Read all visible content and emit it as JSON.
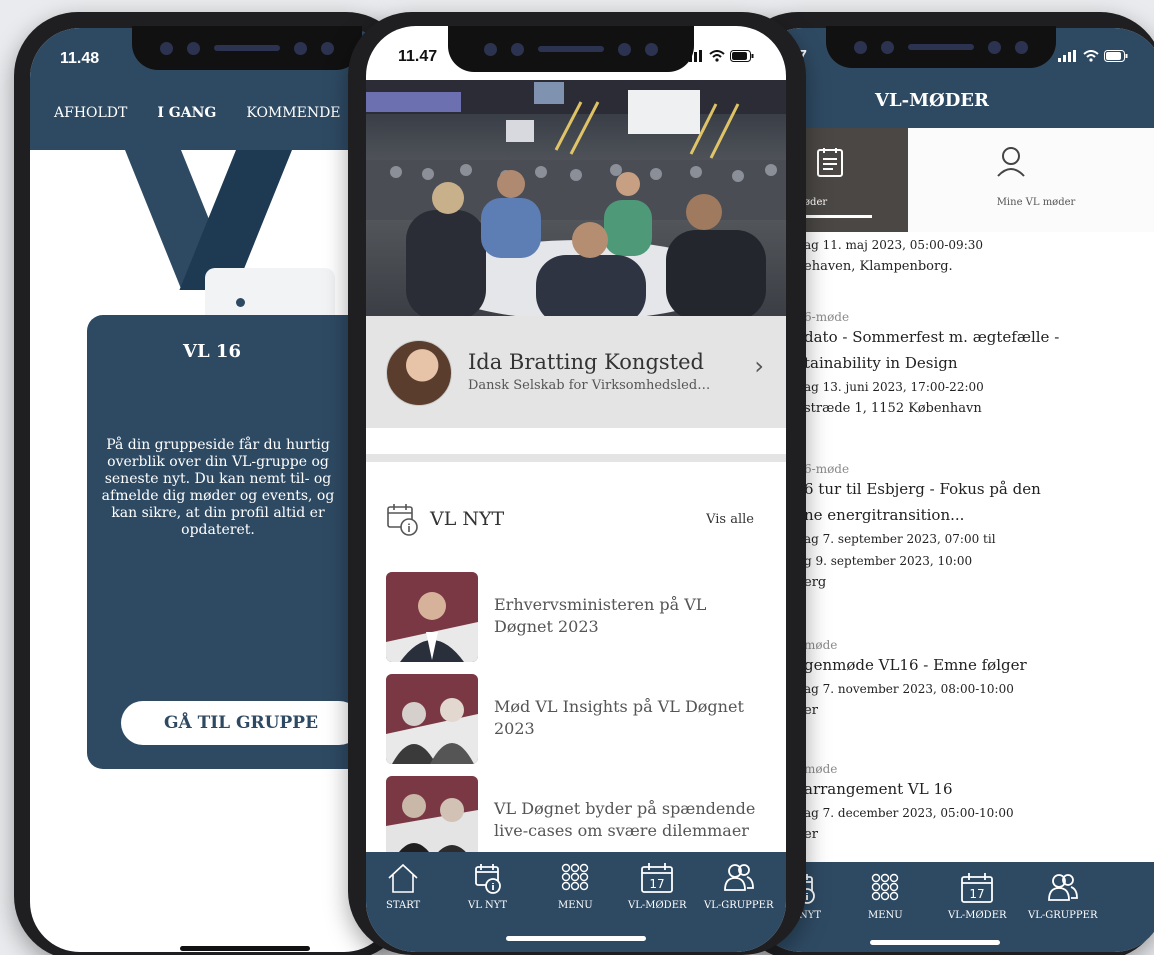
{
  "left_phone": {
    "clock": "11.48",
    "tabs": [
      {
        "label": "AFHOLDT"
      },
      {
        "label": "I GANG"
      },
      {
        "label": "KOMMENDE"
      }
    ],
    "card_title": "VL 16",
    "card_text": "På din gruppeside får du hurtig overblik over din VL-gruppe og seneste nyt. Du kan nemt til- og afmelde dig møder og events, og kan sikre, at din profil altid er opdateret.",
    "button_label": "GÅ TIL GRUPPE"
  },
  "middle_phone": {
    "clock": "11.47",
    "profile": {
      "name": "Ida Bratting Kongsted",
      "org": "Dansk Selskab for Virksomhedsled…"
    },
    "news_header": "VL NYT",
    "see_all": "Vis alle",
    "news": [
      {
        "title": "Erhvervsministeren på VL Døgnet 2023"
      },
      {
        "title": "Mød VL Insights på VL Døgnet 2023"
      },
      {
        "title": "VL Døgnet byder på spændende live-cases om svære dilemmaer"
      }
    ],
    "nav": [
      {
        "label": "START",
        "icon": "house-icon"
      },
      {
        "label": "VL NYT",
        "icon": "news-calendar-icon"
      },
      {
        "label": "MENU",
        "icon": "grid-dots-icon"
      },
      {
        "label": "VL-MØDER",
        "icon": "calendar-17-icon"
      },
      {
        "label": "VL-GRUPPER",
        "icon": "people-icon"
      }
    ],
    "calendar_day": "17"
  },
  "right_phone": {
    "clock": "7",
    "title": "VL-MØDER",
    "tab_all": "lle VL møder",
    "tab_mine": "Mine VL møder",
    "events": [
      {
        "kind": "",
        "name": "",
        "date1": "ag 11. maj 2023, 05:00-09:30",
        "date2": "",
        "loc": "ehaven, Klampenborg."
      },
      {
        "kind": "6-møde",
        "name1": "dato - Sommerfest m. ægtefælle -",
        "name2": "tainability in Design",
        "date1": "ag 13. juni 2023, 17:00-22:00",
        "date2": "",
        "loc": "stræde 1, 1152 København"
      },
      {
        "kind": "6-møde",
        "name1": "6 tur til Esbjerg - Fokus på den",
        "name2": "ne energitransition...",
        "date1": "ag 7. september 2023, 07:00 til",
        "date2": "g 9. september 2023, 10:00",
        "loc": "erg"
      },
      {
        "kind": "møde",
        "name1": "genmøde VL16 - Emne følger",
        "name2": "",
        "date1": "ag 7. november 2023, 08:00-10:00",
        "date2": "",
        "loc": "er"
      },
      {
        "kind": "møde",
        "name1": "arrangement VL 16",
        "name2": "",
        "date1": "ag 7. december 2023, 05:00-10:00",
        "date2": "",
        "loc": "er"
      }
    ],
    "nav": [
      {
        "label": "VL NYT"
      },
      {
        "label": "MENU"
      },
      {
        "label": "VL-MØDER"
      },
      {
        "label": "VL-GRUPPER"
      }
    ],
    "calendar_day": "17"
  },
  "colors": {
    "navy": "#2e4a63",
    "dark_tab": "#4a4744",
    "background": "#e9ebee"
  }
}
